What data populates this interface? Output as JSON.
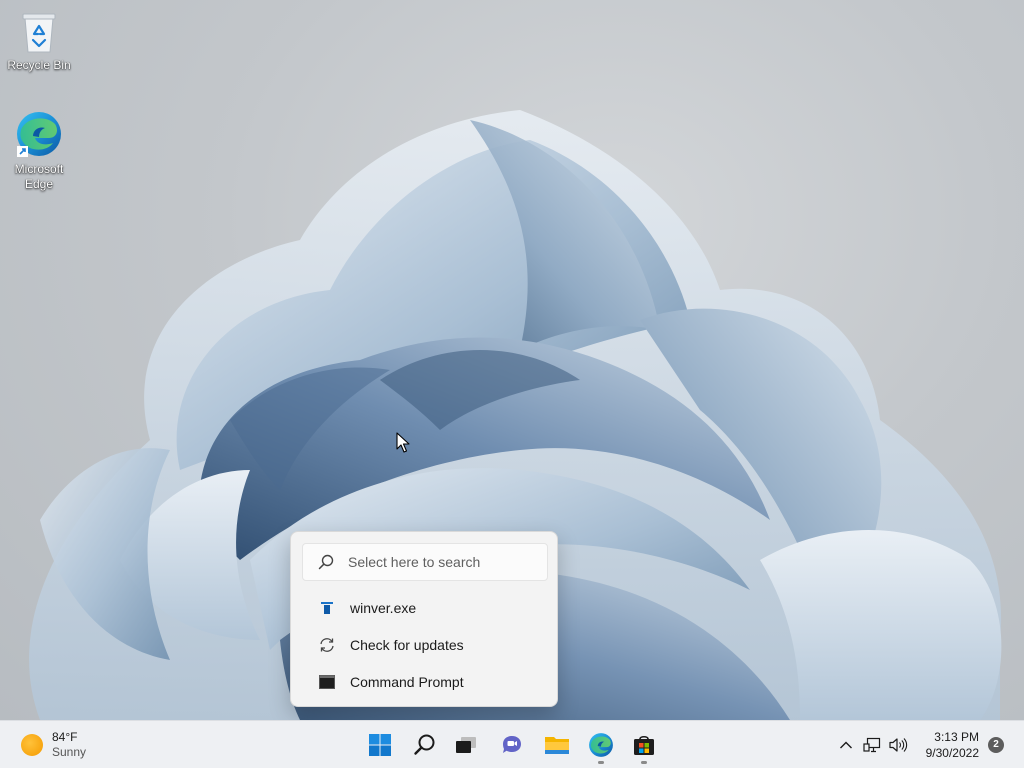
{
  "desktop": {
    "icons": [
      {
        "label": "Recycle Bin",
        "icon": "recycle-bin-icon"
      },
      {
        "label": "Microsoft Edge",
        "icon": "edge-icon"
      }
    ]
  },
  "search_flyout": {
    "placeholder": "Select here to search",
    "items": [
      {
        "label": "winver.exe",
        "icon": "app-icon"
      },
      {
        "label": "Check for updates",
        "icon": "sync-icon"
      },
      {
        "label": "Command Prompt",
        "icon": "terminal-icon"
      }
    ]
  },
  "taskbar": {
    "weather": {
      "temperature": "84°F",
      "condition": "Sunny"
    },
    "apps": [
      {
        "name": "Start",
        "icon": "windows-logo-icon"
      },
      {
        "name": "Search",
        "icon": "search-icon"
      },
      {
        "name": "Task View",
        "icon": "task-view-icon"
      },
      {
        "name": "Chat",
        "icon": "chat-icon"
      },
      {
        "name": "File Explorer",
        "icon": "folder-icon"
      },
      {
        "name": "Microsoft Edge",
        "icon": "edge-icon"
      },
      {
        "name": "Microsoft Store",
        "icon": "store-icon"
      }
    ],
    "tray": {
      "time": "3:13 PM",
      "date": "9/30/2022",
      "notification_count": "2"
    }
  },
  "colors": {
    "accent": "#0067c0",
    "taskbar_bg": "#eef0f3",
    "flyout_bg": "#f3f3f3",
    "wallpaper_bg": "#c3c7cb"
  }
}
